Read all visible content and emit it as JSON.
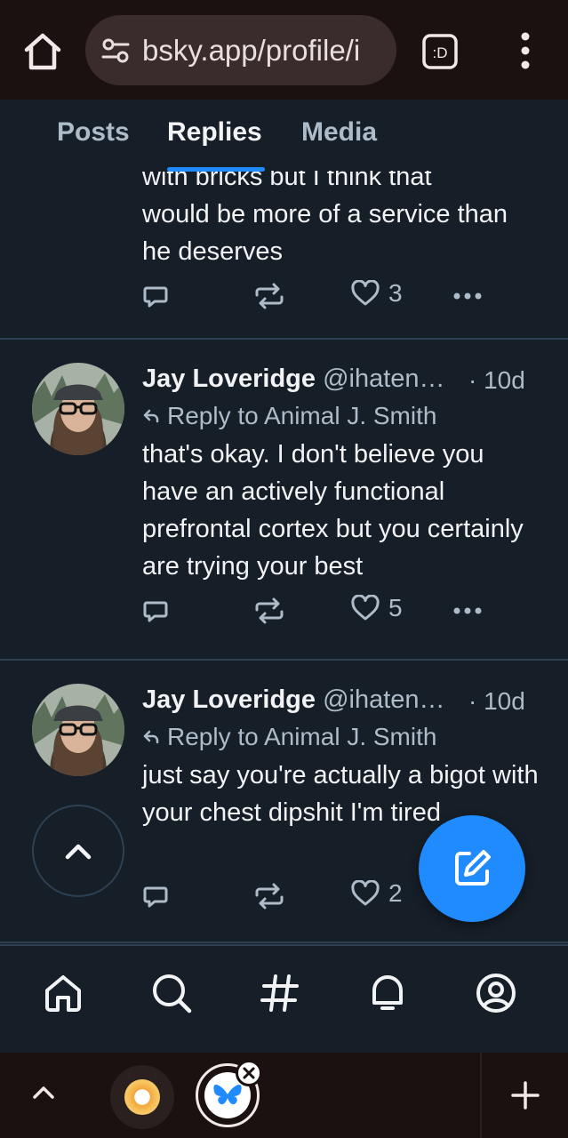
{
  "browser": {
    "url": "bsky.app/profile/i",
    "tabs_label": ":D"
  },
  "profile_tabs": [
    {
      "label": "Posts",
      "active": false
    },
    {
      "label": "Replies",
      "active": true
    },
    {
      "label": "Media",
      "active": false
    }
  ],
  "posts": [
    {
      "text_cut_line": "with bricks but I think that",
      "text": "would be more of a service than he deserves",
      "likes": "3"
    },
    {
      "author": "Jay Loveridge",
      "handle": "@ihaten…",
      "time": "· 10d",
      "reply_to": "Reply to Animal J. Smith",
      "text": "that's okay. I don't believe you have an actively functional prefrontal cortex but you certainly are trying your best",
      "likes": "5"
    },
    {
      "author": "Jay Loveridge",
      "handle": "@ihaten…",
      "time": "· 10d",
      "reply_to": "Reply to Animal J. Smith",
      "text": "just say you're actually a bigot with your chest dipshit I'm tired",
      "likes": "2"
    }
  ],
  "colors": {
    "background": "#161e27",
    "accent": "#208bfe",
    "divider": "#2e4052",
    "muted_text": "#aebbc9"
  },
  "icons": {
    "nav": [
      "home-icon",
      "search-icon",
      "hashtag-icon",
      "bell-icon",
      "profile-icon"
    ],
    "actions": [
      "reply-icon",
      "repost-icon",
      "heart-icon",
      "more-icon"
    ]
  }
}
